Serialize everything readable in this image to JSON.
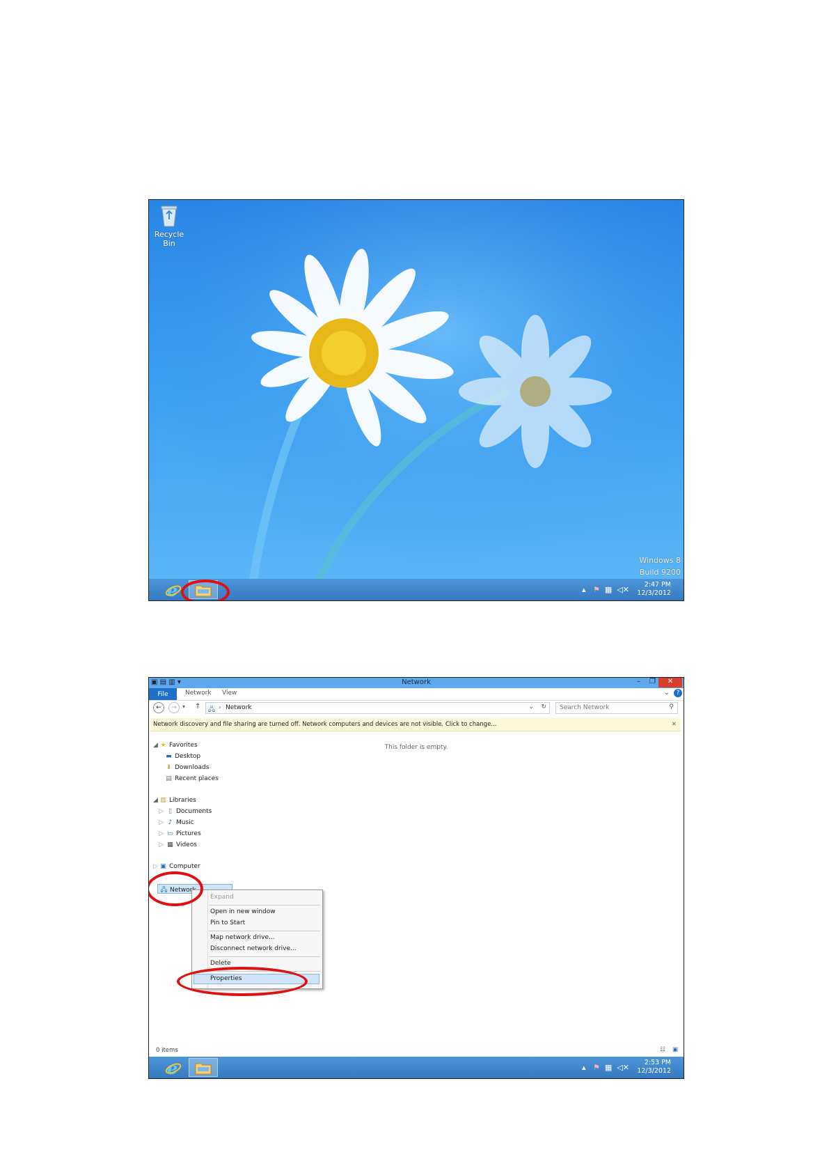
{
  "desktop": {
    "recycle_bin_label": "Recycle Bin",
    "watermark_line1": "Windows 8",
    "watermark_line2": "Build 9200",
    "clock_time": "2:47 PM",
    "clock_date": "12/3/2012"
  },
  "explorer": {
    "window_title": "Network",
    "ribbon": {
      "file": "File",
      "network": "Network",
      "view": "View"
    },
    "address_path": "Network",
    "search_placeholder": "Search Network",
    "info_bar": "Network discovery and file sharing are turned off. Network computers and devices are not visible. Click to change...",
    "empty_message": "This folder is empty.",
    "nav": {
      "favorites": "Favorites",
      "desktop": "Desktop",
      "downloads": "Downloads",
      "recent_places": "Recent places",
      "libraries": "Libraries",
      "documents": "Documents",
      "music": "Music",
      "pictures": "Pictures",
      "videos": "Videos",
      "computer": "Computer",
      "network": "Network"
    },
    "context_menu": {
      "expand": "Expand",
      "open_new_window": "Open in new window",
      "pin_to_start": "Pin to Start",
      "map_drive": "Map network drive...",
      "disconnect_drive": "Disconnect network drive...",
      "delete": "Delete",
      "properties": "Properties"
    },
    "status_items": "0 items",
    "clock_time": "2:53 PM",
    "clock_date": "12/3/2012"
  },
  "colors": {
    "highlight_ring": "#e01010",
    "titlebar": "#5ea8ee",
    "file_tab": "#1e6fc8"
  }
}
